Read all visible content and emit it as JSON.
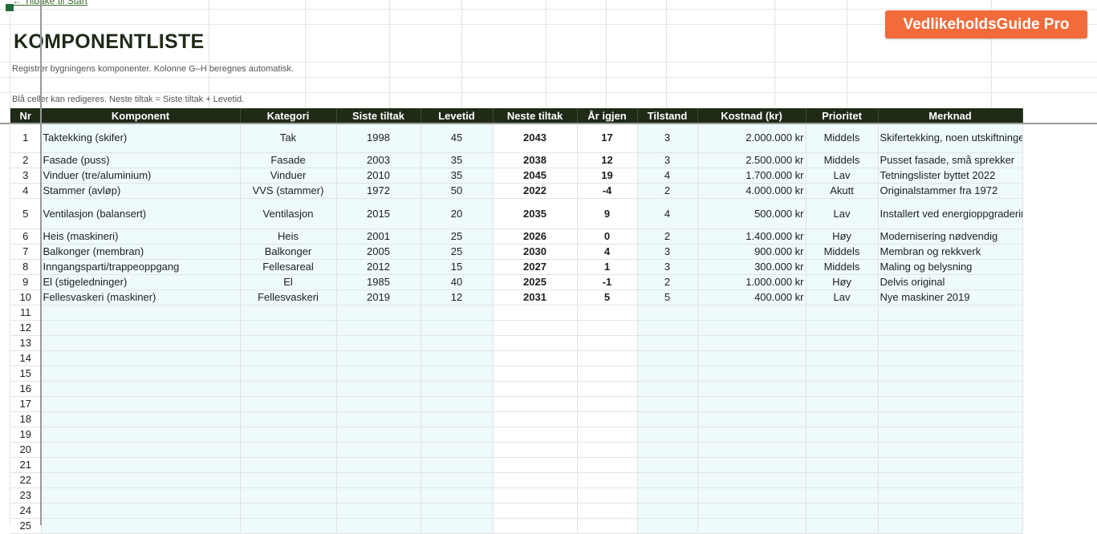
{
  "nav": {
    "back_link": "← Tilbake til Start"
  },
  "brand": {
    "label": "VedlikeholdsGuide Pro",
    "color": "#f26b3a"
  },
  "sheet": {
    "title": "KOMPONENTLISTE",
    "subtitle": "Registrer bygningens komponenter. Kolonne G–H beregnes automatisk.",
    "note": "Blå celler kan redigeres. Neste tiltak = Siste tiltak + Levetid.",
    "header_color": "#1f2a17",
    "editable_color": "#eefafc"
  },
  "columns": [
    "Nr",
    "Komponent",
    "Kategori",
    "Siste tiltak",
    "Levetid",
    "Neste tiltak",
    "År igjen",
    "Tilstand",
    "Kostnad (kr)",
    "Prioritet",
    "Merknad"
  ],
  "rows": [
    {
      "nr": "1",
      "komponent": "Taktekking (skifer)",
      "kategori": "Tak",
      "siste": "1998",
      "levetid": "45",
      "neste": "2043",
      "aar": "17",
      "tilstand": "3",
      "kostnad": "2.000.000 kr",
      "prioritet": "Middels",
      "merknad": "Skifertekking, noen utskiftninger"
    },
    {
      "nr": "2",
      "komponent": "Fasade (puss)",
      "kategori": "Fasade",
      "siste": "2003",
      "levetid": "35",
      "neste": "2038",
      "aar": "12",
      "tilstand": "3",
      "kostnad": "2.500.000 kr",
      "prioritet": "Middels",
      "merknad": "Pusset fasade, små sprekker"
    },
    {
      "nr": "3",
      "komponent": "Vinduer (tre/aluminium)",
      "kategori": "Vinduer",
      "siste": "2010",
      "levetid": "35",
      "neste": "2045",
      "aar": "19",
      "tilstand": "4",
      "kostnad": "1.700.000 kr",
      "prioritet": "Lav",
      "merknad": "Tetningslister byttet 2022"
    },
    {
      "nr": "4",
      "komponent": "Stammer (avløp)",
      "kategori": "VVS (stammer)",
      "siste": "1972",
      "levetid": "50",
      "neste": "2022",
      "aar": "-4",
      "tilstand": "2",
      "kostnad": "4.000.000 kr",
      "prioritet": "Akutt",
      "merknad": "Originalstammer fra 1972"
    },
    {
      "nr": "5",
      "komponent": "Ventilasjon (balansert)",
      "kategori": "Ventilasjon",
      "siste": "2015",
      "levetid": "20",
      "neste": "2035",
      "aar": "9",
      "tilstand": "4",
      "kostnad": "500.000 kr",
      "prioritet": "Lav",
      "merknad": "Installert ved energioppgradering"
    },
    {
      "nr": "6",
      "komponent": "Heis (maskineri)",
      "kategori": "Heis",
      "siste": "2001",
      "levetid": "25",
      "neste": "2026",
      "aar": "0",
      "tilstand": "2",
      "kostnad": "1.400.000 kr",
      "prioritet": "Høy",
      "merknad": "Modernisering nødvendig"
    },
    {
      "nr": "7",
      "komponent": "Balkonger (membran)",
      "kategori": "Balkonger",
      "siste": "2005",
      "levetid": "25",
      "neste": "2030",
      "aar": "4",
      "tilstand": "3",
      "kostnad": "900.000 kr",
      "prioritet": "Middels",
      "merknad": "Membran og rekkverk"
    },
    {
      "nr": "8",
      "komponent": "Inngangsparti/trappeoppgang",
      "kategori": "Fellesareal",
      "siste": "2012",
      "levetid": "15",
      "neste": "2027",
      "aar": "1",
      "tilstand": "3",
      "kostnad": "300.000 kr",
      "prioritet": "Middels",
      "merknad": "Maling og belysning"
    },
    {
      "nr": "9",
      "komponent": "El (stigeledninger)",
      "kategori": "El",
      "siste": "1985",
      "levetid": "40",
      "neste": "2025",
      "aar": "-1",
      "tilstand": "2",
      "kostnad": "1.000.000 kr",
      "prioritet": "Høy",
      "merknad": "Delvis original"
    },
    {
      "nr": "10",
      "komponent": "Fellesvaskeri (maskiner)",
      "kategori": "Fellesvaskeri",
      "siste": "2019",
      "levetid": "12",
      "neste": "2031",
      "aar": "5",
      "tilstand": "5",
      "kostnad": "400.000 kr",
      "prioritet": "Lav",
      "merknad": "Nye maskiner 2019"
    },
    {
      "nr": "11"
    },
    {
      "nr": "12"
    },
    {
      "nr": "13"
    },
    {
      "nr": "14"
    },
    {
      "nr": "15"
    },
    {
      "nr": "16"
    },
    {
      "nr": "17"
    },
    {
      "nr": "18"
    },
    {
      "nr": "19"
    },
    {
      "nr": "20"
    },
    {
      "nr": "21"
    },
    {
      "nr": "22"
    },
    {
      "nr": "23"
    },
    {
      "nr": "24"
    },
    {
      "nr": "25"
    }
  ]
}
